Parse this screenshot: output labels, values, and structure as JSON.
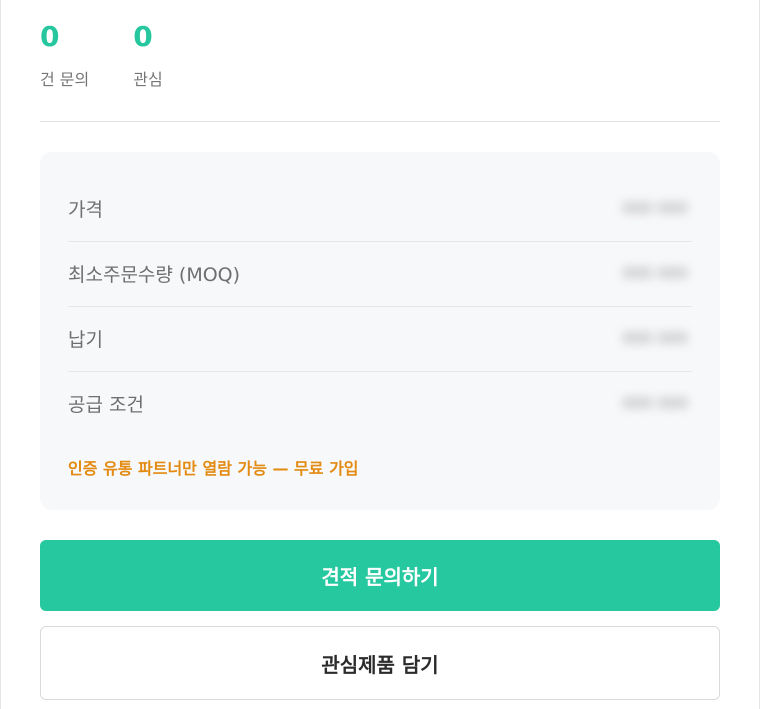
{
  "stats": [
    {
      "value": "0",
      "label": "건 문의"
    },
    {
      "value": "0",
      "label": "관심"
    }
  ],
  "info": {
    "rows": [
      {
        "label": "가격",
        "value": "000 000"
      },
      {
        "label": "최소주문수량 (MOQ)",
        "value": "000 000"
      },
      {
        "label": "납기",
        "value": "000 000"
      },
      {
        "label": "공급 조건",
        "value": "000 000"
      }
    ],
    "notice": "인증 유통 파트너만 열람 가능 — 무료 가입"
  },
  "actions": {
    "primary_label": "견적 문의하기",
    "secondary_label": "관심제품 담기"
  },
  "colors": {
    "accent": "#26c99f",
    "notice": "#e38a10",
    "panel_bg": "#f7f8fa"
  }
}
